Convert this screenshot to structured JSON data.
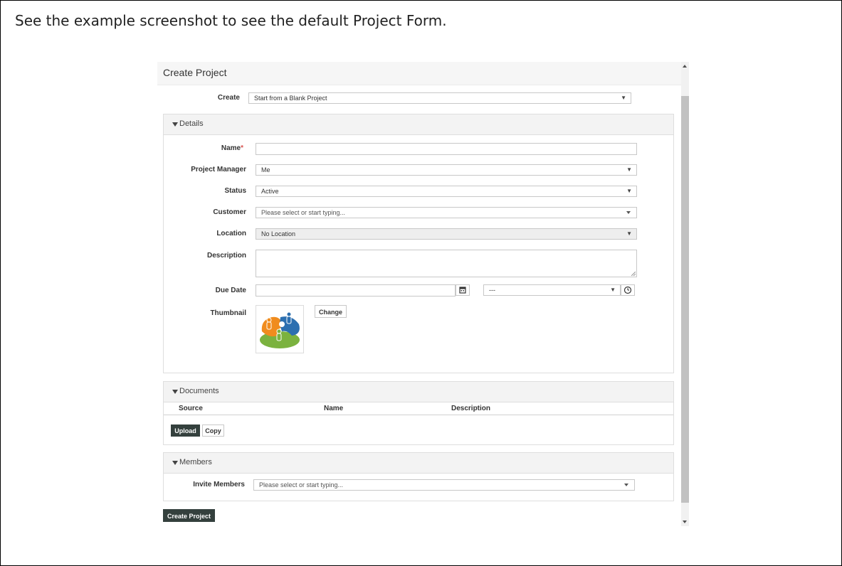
{
  "intro_text": "See the example screenshot to see the default Project Form.",
  "form": {
    "title": "Create Project",
    "create": {
      "label": "Create",
      "value": "Start from a Blank Project"
    },
    "details": {
      "title": "Details",
      "name": {
        "label": "Name",
        "required_mark": "*",
        "value": ""
      },
      "project_manager": {
        "label": "Project Manager",
        "value": "Me"
      },
      "status": {
        "label": "Status",
        "value": "Active"
      },
      "customer": {
        "label": "Customer",
        "placeholder": "Please select or start typing..."
      },
      "location": {
        "label": "Location",
        "value": "No Location"
      },
      "description": {
        "label": "Description",
        "value": ""
      },
      "due_date": {
        "label": "Due Date",
        "date_value": "",
        "time_value": "---"
      },
      "thumbnail": {
        "label": "Thumbnail",
        "change_label": "Change"
      }
    },
    "documents": {
      "title": "Documents",
      "columns": [
        "Source",
        "Name",
        "Description"
      ],
      "upload_label": "Upload",
      "copy_label": "Copy"
    },
    "members": {
      "title": "Members",
      "invite": {
        "label": "Invite Members",
        "placeholder": "Please select or start typing..."
      }
    },
    "submit_label": "Create Project"
  },
  "icons": {
    "dropdown": "triangle-down-icon",
    "calendar": "calendar-icon",
    "clock": "clock-icon",
    "section_toggle": "caret-down-icon"
  },
  "colors": {
    "dark_button": "#34403d",
    "required": "#d9534f"
  }
}
